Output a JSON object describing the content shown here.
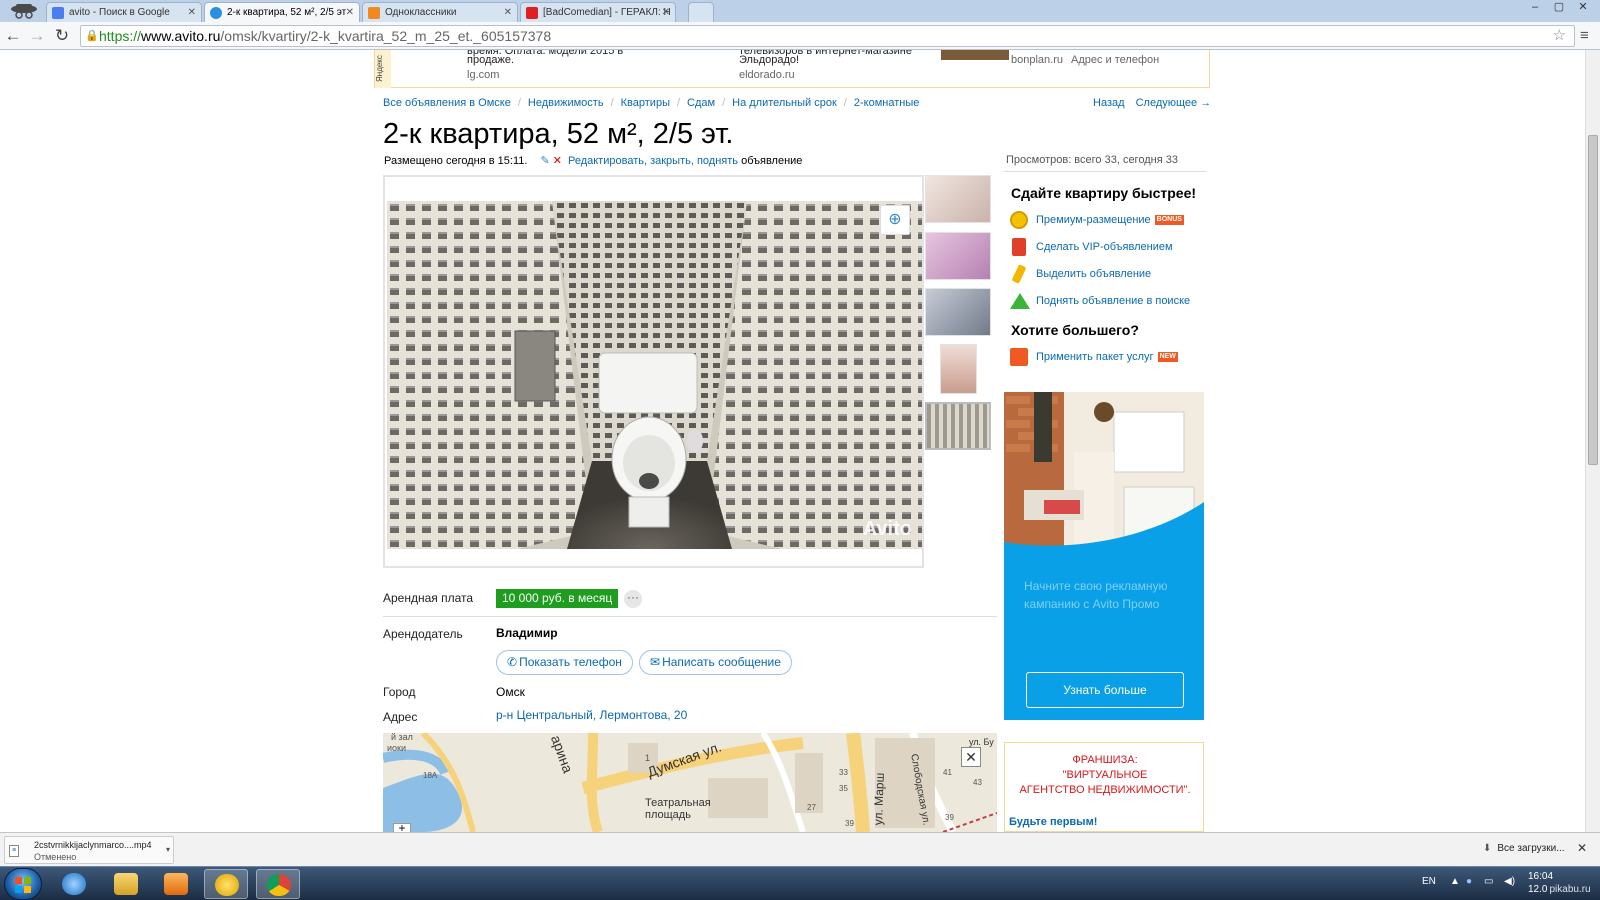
{
  "browser": {
    "tabs": [
      {
        "title": "avito - Поиск в Google",
        "favicon_color": "#4a7ef0"
      },
      {
        "title": "2-к квартира, 52 м², 2/5 эт",
        "favicon_color": "#2a8fe0"
      },
      {
        "title": "Одноклассники",
        "favicon_color": "#f08a1e"
      },
      {
        "title": "[BadComedian] - ГЕРАКЛ: Н",
        "favicon_color": "#e02020"
      }
    ],
    "url_scheme": "https://",
    "url_host": "www.avito.ru",
    "url_path": "/omsk/kvartiry/2-k_kvartira_52_m_25_et._605157378",
    "window_controls": [
      "–",
      "▢",
      "✕"
    ]
  },
  "ad_strip": {
    "yandex_label": "Яндекс",
    "items": [
      {
        "text1": "время. Оплата. модели 2015 в",
        "text2": "продаже.",
        "source": "lg.com"
      },
      {
        "text1": "телевизоров в интернет-магазине",
        "text2": "Эльдорадо!",
        "source": "eldorado.ru"
      },
      {
        "text1": "",
        "text2": "",
        "source": "bonplan.ru"
      }
    ],
    "address_phone": "Адрес и телефон"
  },
  "breadcrumbs": [
    "Все объявления в Омске",
    "Недвижимость",
    "Квартиры",
    "Сдам",
    "На длительный срок",
    "2-комнатные"
  ],
  "pager": {
    "back": "Назад",
    "next": "Следующее →"
  },
  "listing": {
    "title": "2-к квартира, 52 м², 2/5 эт.",
    "posted": "Размещено сегодня в 15:11.",
    "edit_links": "Редактировать, закрыть, поднять",
    "edit_suffix": "объявление",
    "views": "Просмотров: всего 33, сегодня 33",
    "watermark": "Avito",
    "thumbnail_count": 5,
    "selected_thumbnail": 5
  },
  "details": {
    "rent_label": "Арендная плата",
    "rent_value": "10 000 руб. в месяц",
    "more": "···",
    "owner_label": "Арендодатель",
    "owner_name": "Владимир",
    "show_phone": "Показать телефон",
    "write_message": "Написать сообщение",
    "city_label": "Город",
    "city_value": "Омск",
    "address_label": "Адрес",
    "address_value": "р-н Центральный, Лермонтова, 20"
  },
  "map": {
    "labels": {
      "street1": "Думская ул.",
      "street2": "ул. Марш",
      "street3": "Слободская ул.",
      "street4": "арина",
      "street5": "ул. Бу",
      "square": "Театральная\nплощадь",
      "zal": "й зал",
      "ioki": "иоки",
      "n18": "18А",
      "n1": "1",
      "n33": "33",
      "n35": "35",
      "n27": "27",
      "n39a": "39",
      "n41": "41",
      "n43": "43",
      "n39b": "39"
    },
    "close": "✕",
    "zoom": "+"
  },
  "sidebar": {
    "sell_faster": "Сдайте квартиру быстрее!",
    "items": [
      {
        "label": "Премиум-размещение",
        "badge": "BONUS",
        "icon_color": "#f2c200"
      },
      {
        "label": "Сделать VIP-объявлением",
        "badge": "",
        "icon_color": "#e0402a"
      },
      {
        "label": "Выделить объявление",
        "badge": "",
        "icon_color": "#f2b600"
      },
      {
        "label": "Поднять объявление в поиске",
        "badge": "",
        "icon_color": "#3cb43c"
      }
    ],
    "want_more": "Хотите большего?",
    "package": {
      "label": "Применить пакет услуг",
      "badge": "NEW",
      "icon_color": "#f05a22"
    }
  },
  "promo": {
    "text": "Начните свою рекламную кампанию с Avito Промо",
    "button": "Узнать больше"
  },
  "franchise": {
    "line1": "ФРАНШИЗА:",
    "line2": "\"ВИРТУАЛЬНОЕ",
    "line3": "АГЕНТСТВО НЕДВИЖИМОСТИ\".",
    "cta": "Будьте первым!"
  },
  "downloads": {
    "filename": "2cstvrnikkijaclynmarco....mp4",
    "status": "Отменено",
    "show_all": "Все загрузки...",
    "close": "✕"
  },
  "taskbar": {
    "lang": "EN",
    "time": "16:04",
    "date": "12.0",
    "watermark": "pikabu.ru"
  }
}
